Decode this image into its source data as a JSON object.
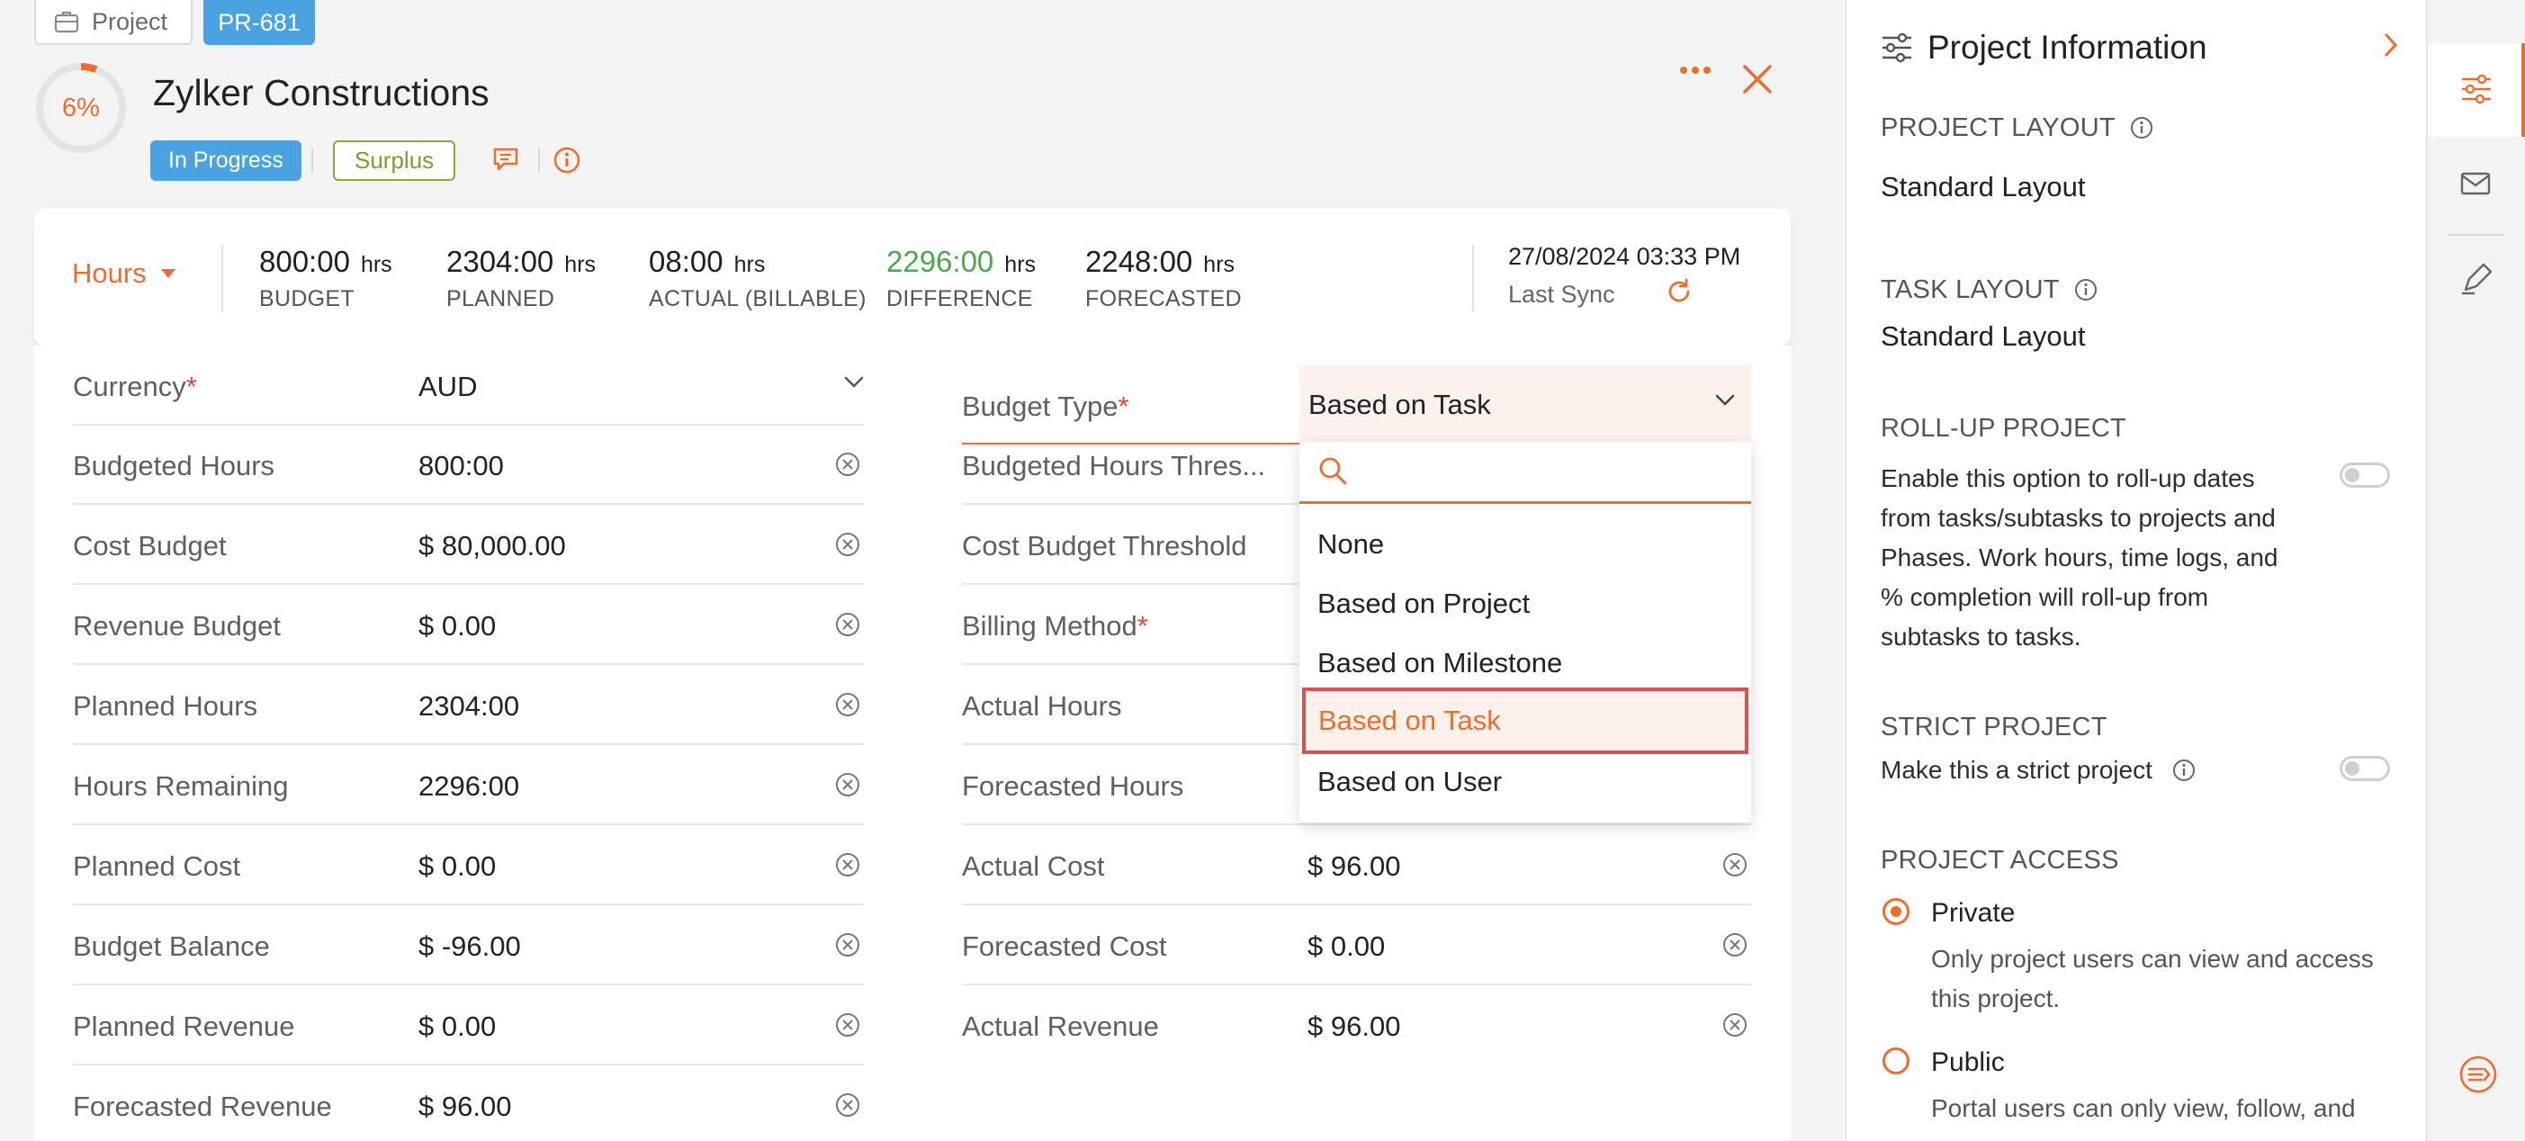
{
  "header": {
    "breadcrumb_label": "Project",
    "project_id": "PR-681",
    "progress_text": "6%",
    "progress_percent": 6,
    "title": "Zylker Constructions",
    "status": "In Progress",
    "budget_status": "Surplus"
  },
  "summary": {
    "mode": "Hours",
    "unit": "hrs",
    "metrics": [
      {
        "value": "800:00",
        "label": "BUDGET"
      },
      {
        "value": "2304:00",
        "label": "PLANNED"
      },
      {
        "value": "08:00",
        "label": "ACTUAL (BILLABLE)"
      },
      {
        "value": "2296:00",
        "label": "DIFFERENCE"
      },
      {
        "value": "2248:00",
        "label": "FORECASTED"
      }
    ],
    "sync_date": "27/08/2024 03:33 PM",
    "sync_label": "Last Sync"
  },
  "form": {
    "left": [
      {
        "label": "Currency",
        "value": "AUD"
      },
      {
        "label": "Budgeted Hours",
        "value": "800:00"
      },
      {
        "label": "Cost Budget",
        "value": "$ 80,000.00"
      },
      {
        "label": "Revenue Budget",
        "value": "$ 0.00"
      },
      {
        "label": "Planned Hours",
        "value": "2304:00"
      },
      {
        "label": "Hours Remaining",
        "value": "2296:00"
      },
      {
        "label": "Planned Cost",
        "value": "$ 0.00"
      },
      {
        "label": "Budget Balance",
        "value": "$ -96.00"
      },
      {
        "label": "Planned Revenue",
        "value": "$ 0.00"
      },
      {
        "label": "Forecasted Revenue",
        "value": "$ 96.00"
      }
    ],
    "right": [
      {
        "label": "Budget Type",
        "value": "Based on Task"
      },
      {
        "label": "Budgeted Hours Thres...",
        "value": ""
      },
      {
        "label": "Cost Budget Threshold",
        "value": ""
      },
      {
        "label": "Billing Method",
        "value": ""
      },
      {
        "label": "Actual Hours",
        "value": ""
      },
      {
        "label": "Forecasted Hours",
        "value": ""
      },
      {
        "label": "Actual Cost",
        "value": "$ 96.00"
      },
      {
        "label": "Forecasted Cost",
        "value": "$ 0.00"
      },
      {
        "label": "Actual Revenue",
        "value": "$ 96.00"
      }
    ],
    "required_mark": "*"
  },
  "dropdown": {
    "search_placeholder": "",
    "options": [
      "None",
      "Based on Project",
      "Based on Milestone",
      "Based on Task",
      "Based on User"
    ],
    "selected": "Based on Task"
  },
  "panel": {
    "title": "Project Information",
    "project_layout_heading": "PROJECT LAYOUT",
    "project_layout_value": "Standard Layout",
    "task_layout_heading": "TASK LAYOUT",
    "task_layout_value": "Standard Layout",
    "rollup_heading": "ROLL-UP PROJECT",
    "rollup_desc": "Enable this option to roll-up dates from tasks/subtasks to projects and Phases. Work hours, time logs, and % completion will roll-up from subtasks to tasks.",
    "rollup_enabled": false,
    "strict_heading": "STRICT PROJECT",
    "strict_desc": "Make this a strict project",
    "strict_enabled": false,
    "access_heading": "PROJECT ACCESS",
    "private_label": "Private",
    "private_desc": "Only project users can view and access this project.",
    "public_label": "Public",
    "public_desc": "Portal users can only view, follow, and",
    "access_selected": "Private"
  },
  "colors": {
    "accent": "#ec6d2f",
    "status_blue": "#4ba2e3",
    "surplus_green": "#7e9d2f",
    "difference_green": "#4aa84c",
    "required_red": "#e6443a"
  }
}
